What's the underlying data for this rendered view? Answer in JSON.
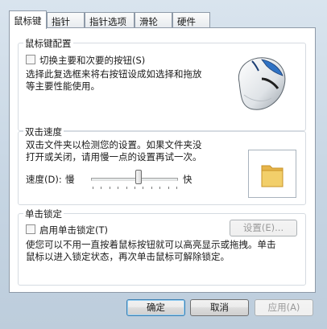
{
  "tabs": [
    {
      "label": "鼠标键"
    },
    {
      "label": "指针"
    },
    {
      "label": "指针选项"
    },
    {
      "label": "滑轮"
    },
    {
      "label": "硬件"
    }
  ],
  "button_config": {
    "title": "鼠标键配置",
    "switch_checkbox_label": "切换主要和次要的按钮(S)",
    "switch_checked": false,
    "description_line1": "选择此复选框来将右按钮设成如选择和拖放",
    "description_line2": "等主要性能使用。",
    "image_icon": "mouse-image"
  },
  "double_click": {
    "title": "双击速度",
    "description_line1": "双击文件夹以检测您的设置。如果文件夹没",
    "description_line2": "打开或关闭，请用慢一点的设置再试一次。",
    "speed_label": "速度(D):",
    "slow_label": "慢",
    "fast_label": "快",
    "speed_level": 0.55,
    "test_icon": "folder-icon"
  },
  "click_lock": {
    "title": "单击锁定",
    "checkbox_label": "启用单击锁定(T)",
    "checked": false,
    "settings_button": "设置(E)...",
    "description_line1": "使您可以不用一直按着鼠标按钮就可以高亮显示或拖拽。单击",
    "description_line2": "鼠标以进入锁定状态，再次单击鼠标可解除锁定。"
  },
  "footer": {
    "ok": "确定",
    "cancel": "取消",
    "apply": "应用(A)"
  },
  "colors": {
    "accent_blue": "#2f72c4",
    "folder_yellow": "#f2cf6a"
  }
}
